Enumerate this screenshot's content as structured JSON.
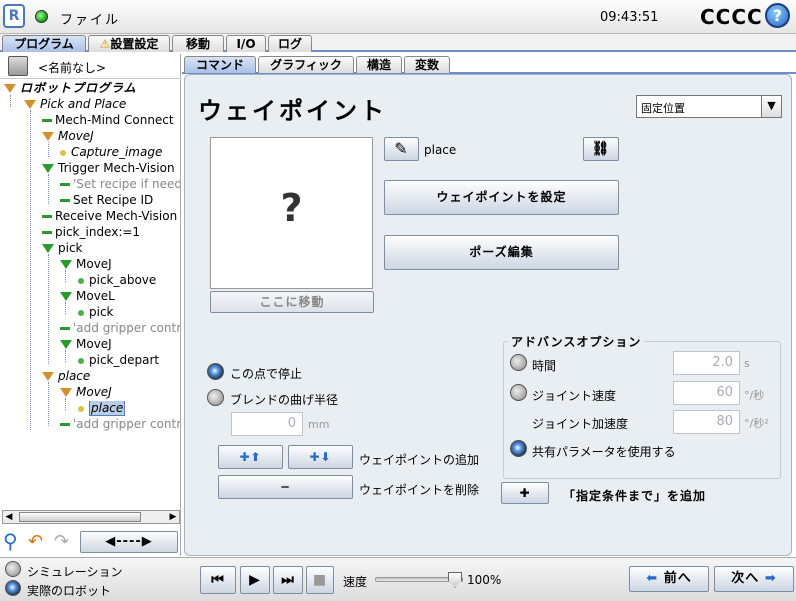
{
  "header": {
    "file_label": "ファイル",
    "clock": "09:43:51",
    "robot_name": "CCCC",
    "help": "?"
  },
  "main_tabs": [
    "プログラム",
    "設置設定",
    "移動",
    "I/O",
    "ログ"
  ],
  "program_name": "<名前なし>",
  "tree": [
    {
      "label": "ロボットプログラム",
      "kind": "root"
    },
    {
      "label": "Pick and Place",
      "kind": "folder",
      "italic": true
    },
    {
      "label": "Mech-Mind Connect",
      "kind": "cmd"
    },
    {
      "label": "MoveJ",
      "kind": "folder",
      "italic": true
    },
    {
      "label": "Capture_image",
      "kind": "wp",
      "italic": true
    },
    {
      "label": "Trigger Mech-Vision",
      "kind": "move"
    },
    {
      "label": "'Set recipe if needed",
      "kind": "comment"
    },
    {
      "label": "Set Recipe ID",
      "kind": "cmd"
    },
    {
      "label": "Receive Mech-Vision I",
      "kind": "cmd"
    },
    {
      "label": "pick_index:=1",
      "kind": "cmd"
    },
    {
      "label": "pick",
      "kind": "move"
    },
    {
      "label": "MoveJ",
      "kind": "move"
    },
    {
      "label": "pick_above",
      "kind": "wp"
    },
    {
      "label": "MoveL",
      "kind": "move"
    },
    {
      "label": "pick",
      "kind": "wp"
    },
    {
      "label": "'add gripper control",
      "kind": "comment"
    },
    {
      "label": "MoveJ",
      "kind": "move"
    },
    {
      "label": "pick_depart",
      "kind": "wp"
    },
    {
      "label": "place",
      "kind": "folder",
      "italic": true
    },
    {
      "label": "MoveJ",
      "kind": "folder",
      "italic": true
    },
    {
      "label": "place",
      "kind": "wp",
      "italic": true,
      "selected": true
    },
    {
      "label": "'add gripper control",
      "kind": "comment"
    }
  ],
  "cmd_tabs": [
    "コマンド",
    "グラフィック",
    "構造",
    "変数"
  ],
  "waypoint": {
    "title": "ウェイポイント",
    "type_select": "固定位置",
    "preview": "?",
    "move_here": "ここに移動",
    "name": "place",
    "set_waypoint": "ウェイポイントを設定",
    "edit_pose": "ポーズ編集",
    "stop_here": "この点で停止",
    "blend_radius": "ブレンドの曲げ半径",
    "blend_value": "0",
    "blend_unit": "mm",
    "add_waypoint": "ウェイポイントの追加",
    "delete_waypoint": "ウェイポイントを削除",
    "add_until": "「指定条件まで」を追加",
    "advanced": {
      "title": "アドバンスオプション",
      "time_label": "時間",
      "time_value": "2.0",
      "time_unit": "s",
      "joint_speed_label": "ジョイント速度",
      "joint_speed_value": "60",
      "joint_speed_unit": "°/秒",
      "joint_accel_label": "ジョイント加速度",
      "joint_accel_value": "80",
      "joint_accel_unit": "°/秒²",
      "shared_label": "共有パラメータを使用する"
    }
  },
  "footer": {
    "simulation": "シミュレーション",
    "real_robot": "実際のロボット",
    "speed_label": "速度",
    "speed_value": "100%",
    "speed_fraction": 1.0,
    "prev": "前へ",
    "next": "次へ"
  }
}
